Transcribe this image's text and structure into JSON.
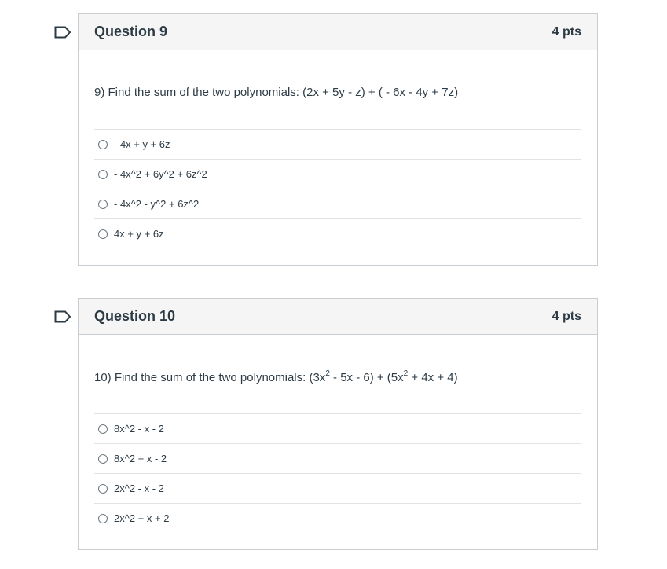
{
  "questions": [
    {
      "title": "Question 9",
      "points": "4 pts",
      "text": "9) Find the sum of the two polynomials: (2x + 5y - z) + ( - 6x - 4y + 7z)",
      "answers": [
        "- 4x + y + 6z",
        "- 4x^2 + 6y^2 + 6z^2",
        "- 4x^2 - y^2 + 6z^2",
        "4x + y + 6z"
      ]
    },
    {
      "title": "Question 10",
      "points": "4 pts",
      "text_parts": {
        "prefix": "10) Find the sum of the two polynomials: (3x",
        "exp1": "2",
        "middle": " - 5x - 6) + (5x",
        "exp2": "2",
        "suffix": " + 4x + 4)"
      },
      "answers": [
        "8x^2 - x - 2",
        "8x^2 + x - 2",
        "2x^2 - x - 2",
        "2x^2 + x + 2"
      ]
    }
  ],
  "colors": {
    "header_bg": "#f5f5f5",
    "border": "#c7cdd1",
    "text": "#2d3b45"
  },
  "icons": {
    "flag": "flag-outline-icon",
    "radio": "radio-unselected-icon"
  }
}
